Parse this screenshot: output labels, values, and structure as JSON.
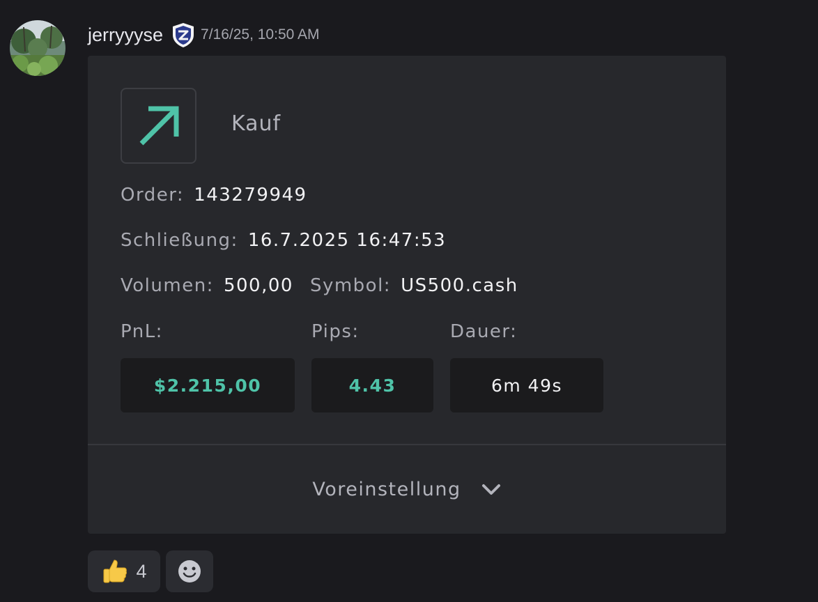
{
  "message": {
    "username": "jerryyyse",
    "badge_icon": "shield-badge-icon",
    "timestamp": "7/16/25, 10:50 AM",
    "avatar_icon": "avatar-jungle-photo"
  },
  "card": {
    "action": {
      "label": "Kauf",
      "icon": "arrow-up-right-icon",
      "color": "#4fc3a8"
    },
    "order": {
      "label": "Order:",
      "value": "143279949"
    },
    "close": {
      "label": "Schließung:",
      "value": "16.7.2025 16:47:53"
    },
    "volume": {
      "label": "Volumen:",
      "value": "500,00"
    },
    "symbol": {
      "label": "Symbol:",
      "value": "US500.cash"
    },
    "pnl": {
      "label": "PnL:",
      "value": "$2.215,00"
    },
    "pips": {
      "label": "Pips:",
      "value": "4.43"
    },
    "duration": {
      "label": "Dauer:",
      "value": "6m 49s"
    },
    "preset": {
      "label": "Voreinstellung",
      "icon": "chevron-down-icon"
    }
  },
  "reactions": [
    {
      "emoji": "thumbs-up-icon",
      "count": "4"
    },
    {
      "emoji": "add-reaction-icon"
    }
  ]
}
